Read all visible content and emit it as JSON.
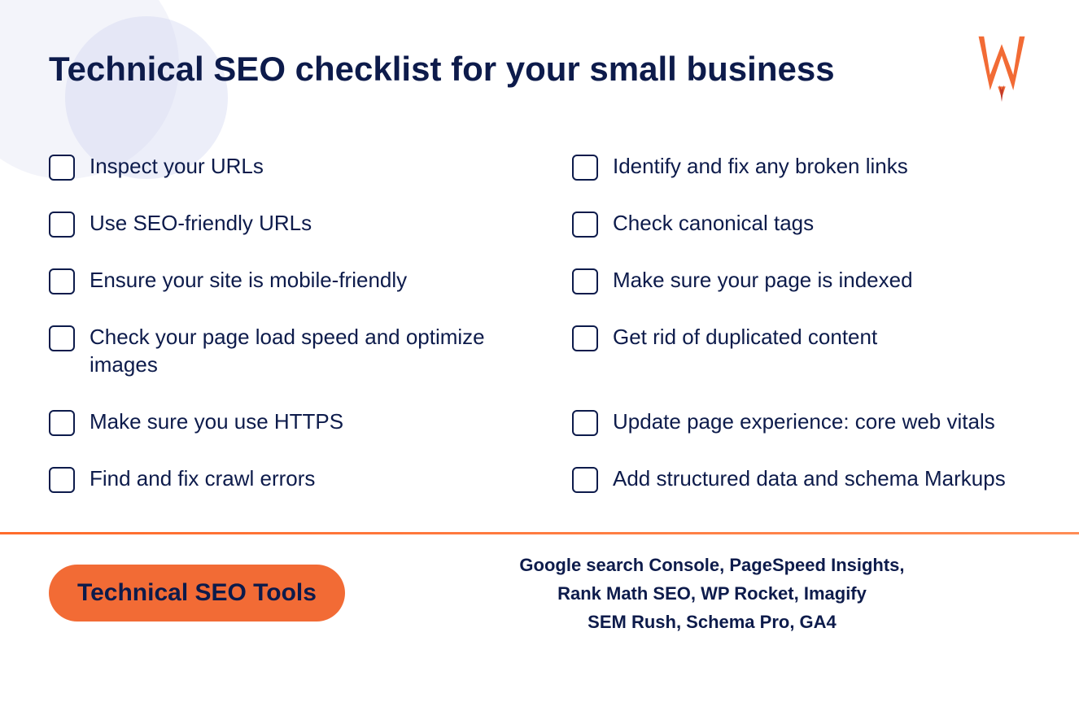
{
  "page": {
    "title": "Technical SEO checklist for your small business",
    "bg_circle_colors": [
      "#e8eaf6",
      "#d0d4f0"
    ]
  },
  "checklist": {
    "left_items": [
      "Inspect your URLs",
      "Use SEO-friendly URLs",
      "Ensure your site is mobile-friendly",
      "Check your page load speed and optimize images",
      "Make sure you use HTTPS",
      "Find and fix crawl errors"
    ],
    "right_items": [
      "Identify and fix any broken links",
      "Check canonical tags",
      "Make sure your page is indexed",
      "Get rid of duplicated content",
      "Update page experience: core web vitals",
      "Add structured data and schema Markups"
    ]
  },
  "footer": {
    "badge_label": "Technical SEO Tools",
    "tools_line1": "Google search Console, PageSpeed Insights,",
    "tools_line2": "Rank Math SEO, WP Rocket, Imagify",
    "tools_line3": "SEM Rush, Schema Pro, GA4"
  },
  "logo": {
    "alt": "W logo icon"
  }
}
